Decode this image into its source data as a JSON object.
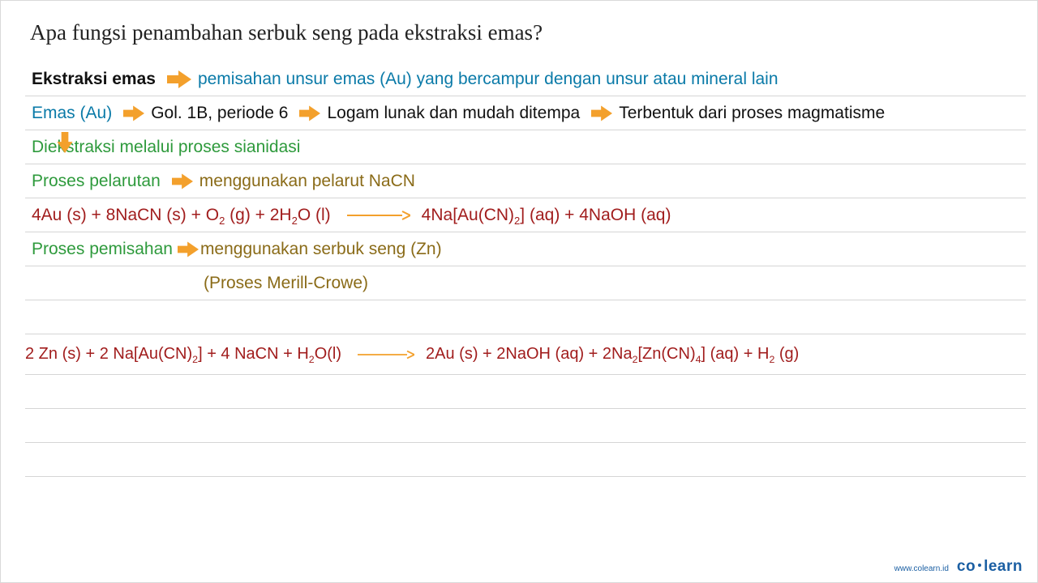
{
  "title": "Apa fungsi penambahan serbuk seng pada ekstraksi emas?",
  "line1": {
    "label": "Ekstraksi emas",
    "desc": "pemisahan unsur emas (Au) yang bercampur dengan unsur atau mineral lain"
  },
  "line2": {
    "a": "Emas (Au)",
    "b": "Gol. 1B, periode 6",
    "c": "Logam lunak dan mudah ditempa",
    "d": "Terbentuk dari proses magmatisme"
  },
  "line3": "Diekstraksi melalui proses sianidasi",
  "line4": {
    "a": "Proses pelarutan",
    "b": "menggunakan pelarut NaCN"
  },
  "eq1": {
    "lhs_parts": [
      "4Au (s) + 8NaCN (s) + O",
      "2",
      " (g) + 2H",
      "2",
      "O (l)"
    ],
    "rhs_parts": [
      "4Na[Au(CN)",
      "2",
      "] (aq) + 4NaOH (aq)"
    ]
  },
  "line6": {
    "a": "Proses pemisahan",
    "b": "menggunakan serbuk seng (Zn)"
  },
  "line7": "(Proses Merill-Crowe)",
  "eq2": {
    "lhs_parts": [
      "2 Zn (s) + 2 Na[Au(CN)",
      "2",
      "] + 4 NaCN + H",
      "2",
      "O(l)"
    ],
    "rhs_parts": [
      "2Au (s) + 2NaOH (aq) + 2Na",
      "2",
      "[Zn(CN)",
      "4",
      "] (aq) + H",
      "2",
      " (g)"
    ]
  },
  "footer": {
    "url": "www.colearn.id",
    "brand_a": "co",
    "brand_b": "learn"
  },
  "colors": {
    "arrow_orange": "#f3a02c"
  }
}
